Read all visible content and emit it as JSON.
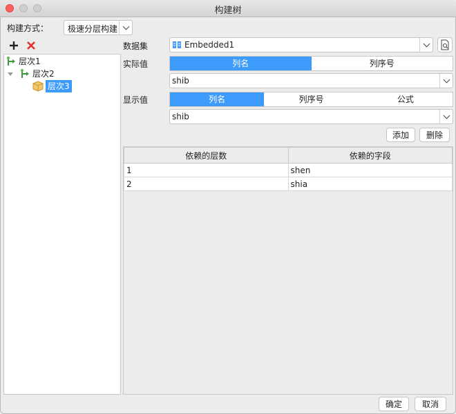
{
  "window": {
    "title": "构建树"
  },
  "build": {
    "label": "构建方式：",
    "value": "极速分层构建"
  },
  "tree": {
    "items": [
      {
        "label": "层次1",
        "level": 0
      },
      {
        "label": "层次2",
        "level": 1
      },
      {
        "label": "层次3",
        "level": 2,
        "selected": true
      }
    ]
  },
  "dataset": {
    "label": "数据集",
    "value": "Embedded1"
  },
  "actual": {
    "label": "实际值",
    "tabs": [
      "列名",
      "列序号"
    ],
    "active_tab": 0,
    "value": "shib"
  },
  "display": {
    "label": "显示值",
    "tabs": [
      "列名",
      "列序号",
      "公式"
    ],
    "active_tab": 0,
    "value": "shib"
  },
  "actions": {
    "add": "添加",
    "delete": "删除"
  },
  "table": {
    "headers": [
      "依赖的层数",
      "依赖的字段"
    ],
    "rows": [
      [
        "1",
        "shen"
      ],
      [
        "2",
        "shia"
      ]
    ]
  },
  "footer": {
    "ok": "确定",
    "cancel": "取消"
  },
  "colors": {
    "accent": "#3d9bfc",
    "close": "#fc605c"
  }
}
